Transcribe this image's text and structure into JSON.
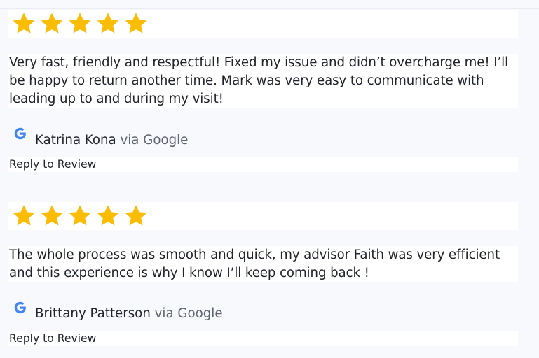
{
  "reviews": [
    {
      "rating": 5,
      "text": "Very fast, friendly and respectful! Fixed my issue and didn’t overcharge me! I’ll be happy to return another time. Mark was very easy to communicate with leading up to and during my visit!",
      "author": "Katrina Kona",
      "via": "via Google",
      "reply_label": "Reply to Review",
      "source_icon": "google-g-icon"
    },
    {
      "rating": 5,
      "text": "The whole process was smooth and quick, my advisor Faith was very efficient and this experience is why I know I’ll keep coming back !",
      "author": "Brittany Patterson",
      "via": "via Google",
      "reply_label": "Reply to Review",
      "source_icon": "google-g-icon"
    }
  ],
  "colors": {
    "star": "#fbbc04",
    "page_background": "#f8f9fd",
    "card_background": "#ffffff",
    "via_text": "#5f6470"
  }
}
